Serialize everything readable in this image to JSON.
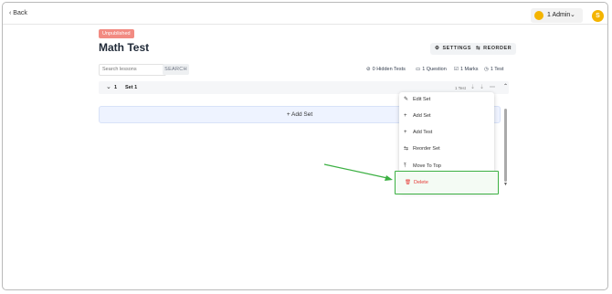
{
  "topbar": {
    "back_label": "Back",
    "admin_label": "1 Admin",
    "avatar_initial": "S"
  },
  "page": {
    "status_badge": "Unpublished",
    "title": "Math Test",
    "settings_label": "SETTINGS",
    "reorder_label": "REORDER"
  },
  "search": {
    "placeholder": "Search lessons",
    "button_label": "SEARCH"
  },
  "stats": {
    "hidden_tests": "0 Hidden Tests",
    "questions": "1 Question",
    "marks": "1 Marks",
    "tests": "1 Test"
  },
  "set": {
    "number": "1",
    "name": "Set 1",
    "tests": "1 Test"
  },
  "add_set_label": "+ Add Set",
  "menu": {
    "items": [
      {
        "icon": "✎",
        "label": "Edit Set"
      },
      {
        "icon": "+",
        "label": "Add Set"
      },
      {
        "icon": "+",
        "label": "Add Test"
      },
      {
        "icon": "⇆",
        "label": "Reorder Set"
      },
      {
        "icon": "⤒",
        "label": "Move To Top"
      }
    ],
    "delete_label": "Delete"
  },
  "colors": {
    "accent_yellow": "#f4b400",
    "badge_red": "#f28b82",
    "highlight_green": "#3cb043",
    "delete_red": "#e53935"
  }
}
